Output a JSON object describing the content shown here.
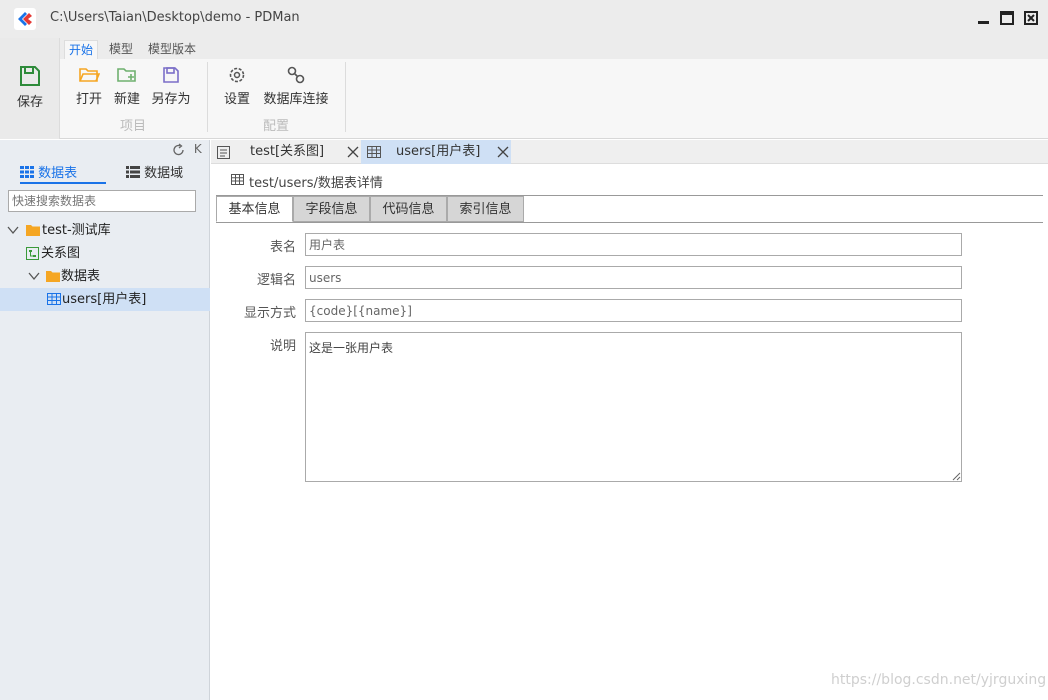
{
  "window": {
    "title": "C:\\Users\\Taian\\Desktop\\demo - PDMan",
    "icons": [
      "app-logo-icon",
      "minimize-icon",
      "maximize-icon",
      "close-icon",
      "exit-icon"
    ]
  },
  "ribbon": {
    "tabs": [
      "开始",
      "模型",
      "模型版本"
    ],
    "active_tab": "开始",
    "save_label": "保存",
    "project_group": {
      "label": "项目",
      "buttons": [
        {
          "label": "打开",
          "icon": "folder-open-icon"
        },
        {
          "label": "新建",
          "icon": "folder-add-icon"
        },
        {
          "label": "另存为",
          "icon": "save-as-icon"
        }
      ]
    },
    "config_group": {
      "label": "配置",
      "buttons": [
        {
          "label": "设置",
          "icon": "gear-icon"
        },
        {
          "label": "数据库连接",
          "icon": "link-icon"
        }
      ]
    }
  },
  "left_panel": {
    "tools": {
      "refresh_icon": "refresh-icon",
      "collapse_label": "K"
    },
    "tabs": [
      {
        "label": "数据表",
        "icon": "grid-icon",
        "active": true
      },
      {
        "label": "数据域",
        "icon": "list-icon",
        "active": false
      }
    ],
    "search_placeholder": "快速搜索数据表",
    "tree": [
      {
        "label": "test-测试库",
        "icon": "folder-icon",
        "expanded": true
      },
      {
        "label": "关系图",
        "icon": "diagram-icon"
      },
      {
        "label": "数据表",
        "icon": "folder-icon",
        "expanded": true
      },
      {
        "label": "users[用户表]",
        "icon": "table-icon",
        "selected": true
      }
    ]
  },
  "doc_tabs": [
    {
      "label": "test[关系图]",
      "icon": "diagram-icon",
      "active": false
    },
    {
      "label": "users[用户表]",
      "icon": "table-icon",
      "active": true
    }
  ],
  "detail": {
    "breadcrumb": "test/users/数据表详情",
    "sub_tabs": [
      "基本信息",
      "字段信息",
      "代码信息",
      "索引信息"
    ],
    "active_sub_tab": "基本信息",
    "form": {
      "name_label": "表名",
      "name_value": "用户表",
      "logical_label": "逻辑名",
      "logical_value": "users",
      "display_label": "显示方式",
      "display_value": "{code}[{name}]",
      "desc_label": "说明",
      "desc_value": "这是一张用户表"
    }
  },
  "watermark": "https://blog.csdn.net/yjrguxing",
  "colors": {
    "accent": "#1a73e8",
    "selected_bg": "#cfe0f5",
    "folder": "#f5a623",
    "save_green": "#2e8b3a"
  }
}
